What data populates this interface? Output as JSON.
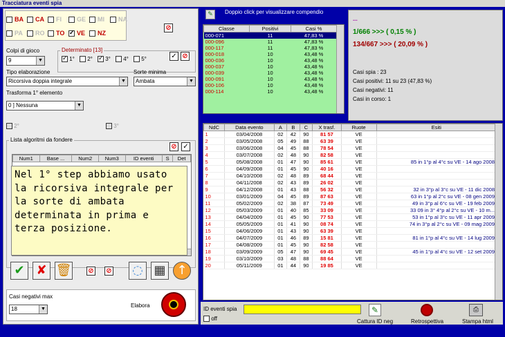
{
  "window_title": "Tracciatura eventi spia",
  "wheels_row1": [
    "BA",
    "CA",
    "FI",
    "GE",
    "MI",
    "NA"
  ],
  "wheels_row1_checked": [
    false,
    false,
    false,
    false,
    false,
    false
  ],
  "wheels_row1_active": [
    true,
    true,
    false,
    false,
    false,
    false
  ],
  "wheels_row2": [
    "PA",
    "RO",
    "TO",
    "VE",
    "NZ"
  ],
  "wheels_row2_checked": [
    false,
    false,
    false,
    true,
    false
  ],
  "wheels_row2_active": [
    false,
    false,
    true,
    true,
    true
  ],
  "colpi": {
    "label": "Colpi di gioco",
    "value": "9"
  },
  "determinato": {
    "label": "Determinato [13]",
    "items": [
      "1°",
      "2°",
      "3°",
      "4°",
      "5°"
    ],
    "checked": [
      true,
      false,
      true,
      false,
      false
    ]
  },
  "tipo": {
    "label": "Tipo elaborazione",
    "value": "Ricorsiva doppia integrale"
  },
  "sorte": {
    "label": "Sorte minima",
    "value": "Ambata"
  },
  "trasforma": {
    "label": "Trasforma 1° elemento",
    "value": "0 ] Nessuna"
  },
  "opt2": "2°",
  "opt3": "3°",
  "lista": {
    "label": "Lista algoritmi da fondere",
    "columns": [
      "Num1",
      "Base ...",
      "Num2",
      "Num3",
      "ID eventi",
      "S",
      "Det"
    ]
  },
  "note_text": "Nel 1° step abbiamo usato la ricorsiva integrale per la sorte di ambata determinata in prima e terza posizione.",
  "casi_negativi": {
    "label": "Casi negativi max",
    "value": "18"
  },
  "elabora": "Elabora",
  "header_hint": "Doppio click per visualizzare compendio",
  "classe_table": {
    "columns": [
      "Classe",
      "Positivi",
      "Casi %"
    ],
    "rows": [
      [
        "000-071",
        "11",
        "47,83 %"
      ],
      [
        "000-096",
        "11",
        "47,83 %"
      ],
      [
        "000-117",
        "11",
        "47,83 %"
      ],
      [
        "000-018",
        "10",
        "43,48 %"
      ],
      [
        "000-036",
        "10",
        "43,48 %"
      ],
      [
        "000-037",
        "10",
        "43,48 %"
      ],
      [
        "000-039",
        "10",
        "43,48 %"
      ],
      [
        "000-091",
        "10",
        "43,48 %"
      ],
      [
        "000-106",
        "10",
        "43,48 %"
      ],
      [
        "000-114",
        "10",
        "43,48 %"
      ]
    ]
  },
  "stats": {
    "dots": "...",
    "line1": "1/666 >>> ( 0,15 % )",
    "line2": "134/667 >>> ( 20,09 % )",
    "casi_spia": "Casi spia : 23",
    "casi_positivi": "Casi positivi: 11 su 23 (47,83 %)",
    "casi_negativi": "Casi negativi: 11",
    "casi_corso": "Casi in corso: 1"
  },
  "events": {
    "columns": [
      "NdC",
      "Data evento",
      "A",
      "B",
      "C",
      "X trasf.",
      "Ruote",
      "Esiti"
    ],
    "rows": [
      [
        "1",
        "03/04/2008",
        "02",
        "42",
        "90",
        "81 57",
        "VE",
        ""
      ],
      [
        "2",
        "03/05/2008",
        "05",
        "49",
        "88",
        "63 39",
        "VE",
        ""
      ],
      [
        "3",
        "03/06/2008",
        "04",
        "45",
        "88",
        "78 54",
        "VE",
        ""
      ],
      [
        "4",
        "03/07/2008",
        "02",
        "48",
        "90",
        "82 58",
        "VE",
        ""
      ],
      [
        "5",
        "05/08/2008",
        "01",
        "47",
        "90",
        "85 61",
        "VE",
        "85 in 1°p al 4°c su VE - 14 ago 2008"
      ],
      [
        "6",
        "04/09/2008",
        "01",
        "45",
        "90",
        "40 16",
        "VE",
        ""
      ],
      [
        "7",
        "04/10/2008",
        "02",
        "48",
        "89",
        "68 44",
        "VE",
        ""
      ],
      [
        "8",
        "04/11/2008",
        "02",
        "43",
        "89",
        "26 02",
        "VE",
        ""
      ],
      [
        "9",
        "04/12/2008",
        "01",
        "43",
        "88",
        "56 32",
        "VE",
        "32 in 3°p al 3°c su VE - 11 dic 2008"
      ],
      [
        "10",
        "03/01/2009",
        "04",
        "45",
        "89",
        "87 63",
        "VE",
        "63 in 1°p al 2°c su VE - 08 gen 2009"
      ],
      [
        "11",
        "05/02/2009",
        "02",
        "38",
        "87",
        "73 49",
        "VE",
        "49 in 3°p al 6°c su VE - 19 feb 2009"
      ],
      [
        "12",
        "05/03/2009",
        "01",
        "40",
        "85",
        "33 09",
        "VE",
        "33 09 in 3° 4°p al 2°c su VE - 10 m..."
      ],
      [
        "13",
        "04/04/2009",
        "01",
        "45",
        "90",
        "77 53",
        "VE",
        "53 in 1°p al 3°c su VE - 11 apr 2009"
      ],
      [
        "14",
        "05/05/2009",
        "01",
        "41",
        "90",
        "08 74",
        "VE",
        "74 in 3°p al 2°c su VE - 09 mag 2009"
      ],
      [
        "15",
        "04/06/2009",
        "01",
        "43",
        "90",
        "63 39",
        "VE",
        ""
      ],
      [
        "16",
        "04/07/2009",
        "01",
        "46",
        "89",
        "15 81",
        "VE",
        "81 in 1°p al 4°c su VE - 14 lug 2009"
      ],
      [
        "17",
        "04/08/2009",
        "01",
        "45",
        "90",
        "82 58",
        "VE",
        ""
      ],
      [
        "18",
        "03/09/2009",
        "05",
        "47",
        "90",
        "69 45",
        "VE",
        "45 in 1°p al 4°c su VE - 12 set 2009"
      ],
      [
        "19",
        "03/10/2009",
        "03",
        "48",
        "88",
        "88 64",
        "VE",
        ""
      ],
      [
        "20",
        "05/11/2009",
        "01",
        "44",
        "90",
        "19 85",
        "VE",
        ""
      ]
    ]
  },
  "bottom": {
    "id_label": "ID eventi spia",
    "off_label": "off",
    "cattura": "Cattura ID neg",
    "retro": "Retrospettiva",
    "stampa": "Stampa html"
  },
  "colors": {
    "bg": "#0000a8",
    "green_rows": "#a0f0a0",
    "note_bg": "#fdfbc4",
    "red": "#e00000"
  }
}
